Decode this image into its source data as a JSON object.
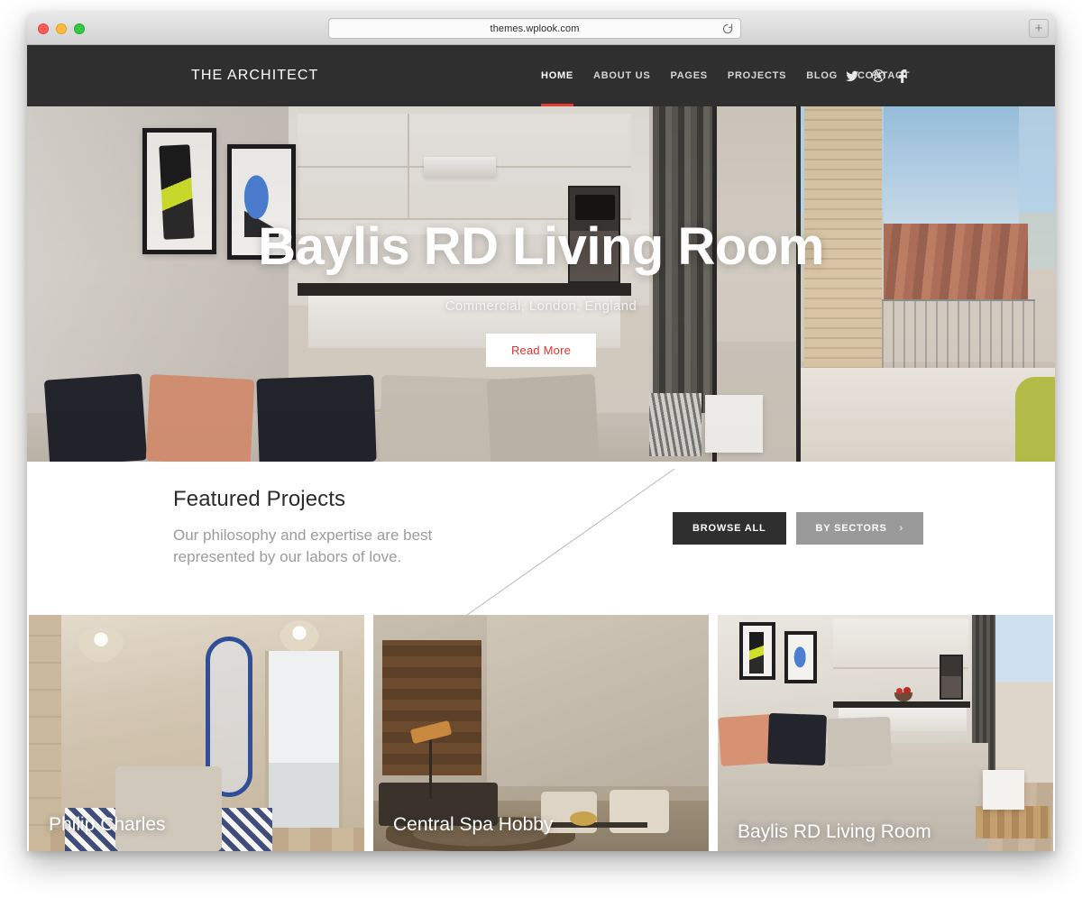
{
  "browser": {
    "url": "themes.wplook.com",
    "reload_icon": "reload-icon",
    "new_tab_label": "+",
    "traffic_lights": [
      "close",
      "minimize",
      "maximize"
    ]
  },
  "site": {
    "brand": "THE ARCHITECT",
    "nav": [
      {
        "label": "HOME",
        "active": true
      },
      {
        "label": "ABOUT US",
        "active": false
      },
      {
        "label": "PAGES",
        "active": false
      },
      {
        "label": "PROJECTS",
        "active": false
      },
      {
        "label": "BLOG",
        "active": false
      },
      {
        "label": "CONTACT",
        "active": false
      }
    ],
    "social": [
      {
        "name": "twitter-icon"
      },
      {
        "name": "dribbble-icon"
      },
      {
        "name": "facebook-icon"
      }
    ],
    "accent_color": "#e23b32",
    "header_bg": "#2f2f2f"
  },
  "hero": {
    "title": "Baylis RD Living Room",
    "subtitle": "Commercial, London, England",
    "cta_label": "Read More",
    "cta_text_color": "#e0352b"
  },
  "featured": {
    "title": "Featured Projects",
    "subtitle": "Our philosophy and expertise are best represented by our labors of love.",
    "browse_all_label": "BROWSE ALL",
    "by_sectors_label": "BY SECTORS",
    "by_sectors_chevron": "›"
  },
  "projects": [
    {
      "title": "Philip Charles"
    },
    {
      "title": "Central Spa Hobby"
    },
    {
      "title": "Baylis RD Living Room"
    }
  ]
}
